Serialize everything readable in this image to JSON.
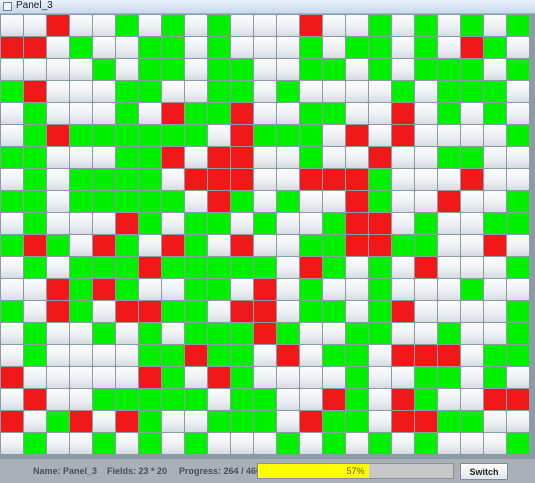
{
  "window": {
    "title": "Panel_3"
  },
  "status": {
    "name": "Name: Panel_3",
    "fields": "Fields: 23 * 20",
    "progress": "Progress: 264 / 460",
    "progress_percent_text": "57%",
    "progress_fraction": 0.57,
    "switch_label": "Switch"
  },
  "colors": {
    "green": "#00f000",
    "red": "#f01818",
    "white": "#f3f5f7",
    "progress": "#ffff00"
  },
  "grid": {
    "columns": 23,
    "rows": [
      "WWRWWGWGWGWWWRWWGWGWGWG",
      "RRWGWWGGWGWWWGWGGWGWRGW",
      "WWWWGWGGWGGWWGGWGWGGGWG",
      "GRWWWGGWWGGWGWWWWGWGGGW",
      "WGWWWGWRGGRWWGGWWRWGWGW",
      "WGRGGGGGGWRGGGWRWRWWWWG",
      "GGWWWGGRWRRWWGWWRWWGGWW",
      "WGWGGGGWRRRWWRRRGWWWRWW",
      "GGWGGGGGWRGWGWWRGWWRWWG",
      "WGWWWRGWGGWGWWGRRWGWWGG",
      "GRGWRGWRGWRWWGGRRGGWWRW",
      "WGWGGGRGGGGGWRGWGWRWWWG",
      "WWRGRGWWGGWRWGWWGWWWGWW",
      "GWRGWRRGGWRRWGGWGRWWWWG",
      "WGWWGWGWGGGRGWWGGWWGWWG",
      "WGWWWWGGRGGWRWGGWRRRWGG",
      "RWWWWWRGWRGWWWWGWWGGWGW",
      "WRWWGGGGGWGGWWRGWRGWWRR",
      "RWGRWRGWWGGGWRGGWRRGGWW",
      "WGWWGWGWGWWWGWGWGWGWWWG"
    ]
  }
}
